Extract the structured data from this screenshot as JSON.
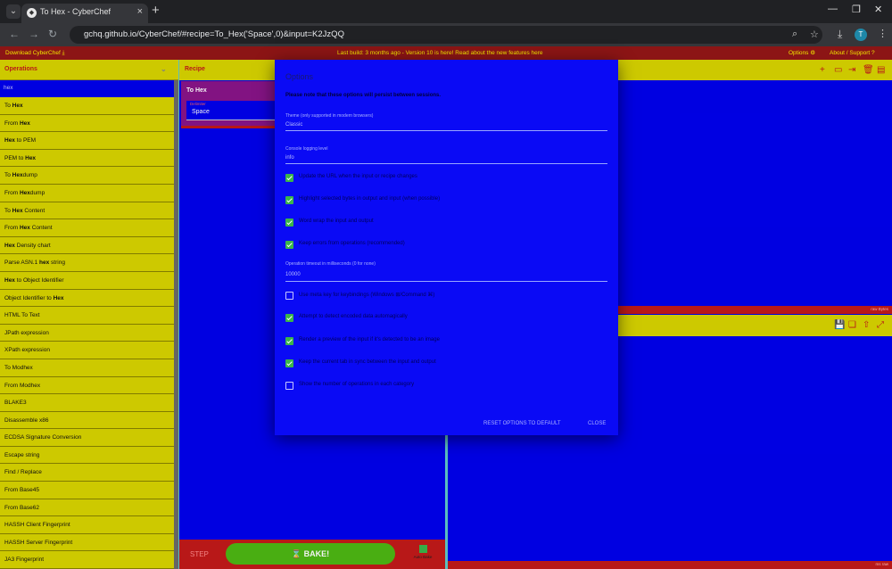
{
  "browser": {
    "tab_title": "To Hex - CyberChef",
    "url": "gchq.github.io/CyberChef/#recipe=To_Hex('Space',0)&input=K2JzQQ",
    "avatar_letter": "T"
  },
  "banner": {
    "download": "Download CyberChef",
    "build_notice": "Last build: 3 months ago - Version 10 is here! Read about the new features here",
    "options": "Options",
    "about": "About / Support"
  },
  "operations": {
    "title": "Operations",
    "search_value": "hex",
    "items": [
      {
        "pre": "To ",
        "bold": "Hex",
        "post": ""
      },
      {
        "pre": "From ",
        "bold": "Hex",
        "post": ""
      },
      {
        "pre": "",
        "bold": "Hex",
        "post": " to PEM"
      },
      {
        "pre": "PEM to ",
        "bold": "Hex",
        "post": ""
      },
      {
        "pre": "To ",
        "bold": "Hex",
        "post": "dump"
      },
      {
        "pre": "From ",
        "bold": "Hex",
        "post": "dump"
      },
      {
        "pre": "To ",
        "bold": "Hex",
        "post": " Content"
      },
      {
        "pre": "From ",
        "bold": "Hex",
        "post": " Content"
      },
      {
        "pre": "",
        "bold": "Hex",
        "post": " Density chart"
      },
      {
        "pre": "Parse ASN.1 ",
        "bold": "hex",
        "post": " string"
      },
      {
        "pre": "",
        "bold": "Hex",
        "post": " to Object Identifier"
      },
      {
        "pre": "Object Identifier to ",
        "bold": "Hex",
        "post": ""
      },
      {
        "pre": "HTML To Text",
        "bold": "",
        "post": ""
      },
      {
        "pre": "JPath expression",
        "bold": "",
        "post": ""
      },
      {
        "pre": "XPath expression",
        "bold": "",
        "post": ""
      },
      {
        "pre": "To Modhex",
        "bold": "",
        "post": ""
      },
      {
        "pre": "From Modhex",
        "bold": "",
        "post": ""
      },
      {
        "pre": "BLAKE3",
        "bold": "",
        "post": ""
      },
      {
        "pre": "Disassemble x86",
        "bold": "",
        "post": ""
      },
      {
        "pre": "ECDSA Signature Conversion",
        "bold": "",
        "post": ""
      },
      {
        "pre": "Escape string",
        "bold": "",
        "post": ""
      },
      {
        "pre": "Find / Replace",
        "bold": "",
        "post": ""
      },
      {
        "pre": "From Base45",
        "bold": "",
        "post": ""
      },
      {
        "pre": "From Base62",
        "bold": "",
        "post": ""
      },
      {
        "pre": "HASSH Client Fingerprint",
        "bold": "",
        "post": ""
      },
      {
        "pre": "HASSH Server Fingerprint",
        "bold": "",
        "post": ""
      },
      {
        "pre": "JA3 Fingerprint",
        "bold": "",
        "post": ""
      }
    ]
  },
  "recipe": {
    "title": "Recipe",
    "op_name": "To Hex",
    "arg_label": "Delimiter",
    "arg_value": "Space",
    "step": "STEP",
    "bake": "BAKE!",
    "auto_bake": "Auto Bake"
  },
  "io": {
    "status_text": "raw Bytes",
    "output_status_text": "ms  raw"
  },
  "options_modal": {
    "title": "Options",
    "hint": "Please note that these options will persist between sessions.",
    "theme_label": "Theme (only supported in modern browsers)",
    "theme_value": "Classic",
    "console_label": "Console logging level",
    "console_value": "info",
    "checkboxes_a": [
      {
        "label": "Update the URL when the input or recipe changes",
        "checked": true
      },
      {
        "label": "Highlight selected bytes in output and input (when possible)",
        "checked": true
      },
      {
        "label": "Word wrap the input and output",
        "checked": true
      },
      {
        "label": "Keep errors from operations (recommended)",
        "checked": true
      }
    ],
    "timeout_label": "Operation timeout in milliseconds (0 for none)",
    "timeout_value": "10000",
    "checkboxes_b": [
      {
        "label": "Use meta key for keybindings (Windows ⊞/Command ⌘)",
        "checked": false
      },
      {
        "label": "Attempt to detect encoded data automagically",
        "checked": true
      },
      {
        "label": "Render a preview of the input if it's detected to be an image",
        "checked": true
      },
      {
        "label": "Keep the current tab in sync between the input and output",
        "checked": true
      },
      {
        "label": "Show the number of operations in each category",
        "checked": false
      }
    ],
    "reset_label": "RESET OPTIONS TO DEFAULT",
    "close_label": "CLOSE"
  },
  "colors": {
    "accent_red": "#c21a1a",
    "accent_yellow": "#d9d400",
    "panel_blue": "#0000ee",
    "bake_green": "#4db814"
  }
}
